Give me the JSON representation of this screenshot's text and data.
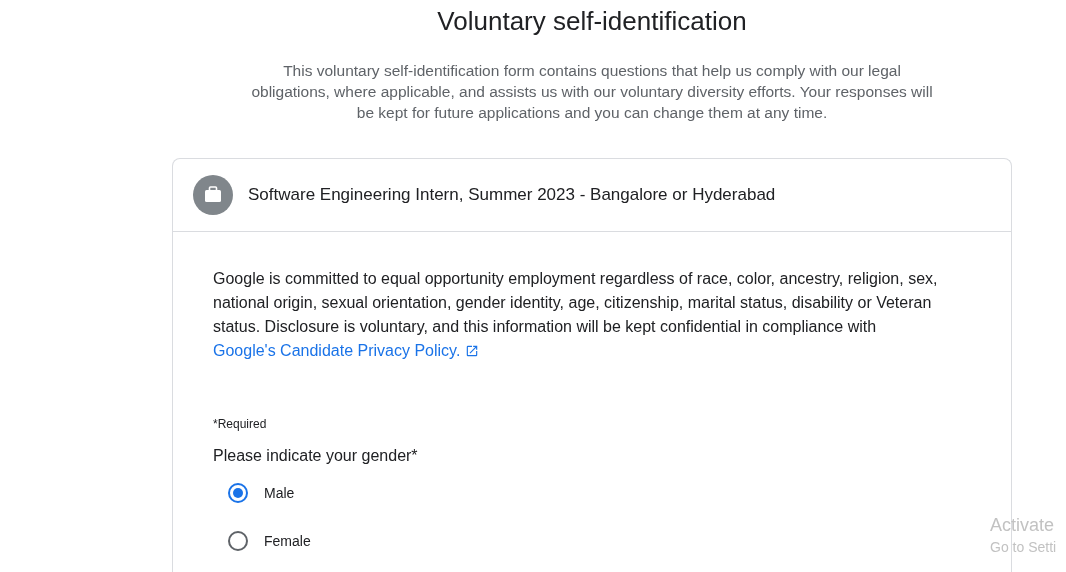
{
  "page": {
    "title": "Voluntary self-identification",
    "description": "This voluntary self-identification form contains questions that help us comply with our legal obligations, where applicable, and assists us with our voluntary diversity efforts. Your responses will be kept for future applications and you can change them at any time."
  },
  "card": {
    "job_title": "Software Engineering Intern, Summer 2023 - Bangalore or Hyderabad",
    "statement": "Google is committed to equal opportunity employment regardless of race, color, ancestry, religion, sex, national origin, sexual orientation, gender identity, age, citizenship, marital status, disability or Veteran status. Disclosure is voluntary, and this information will be kept confidential in compliance with",
    "policy_link": "Google's Candidate Privacy Policy.",
    "required_note": "*Required",
    "question": "Please indicate your gender*",
    "options": [
      {
        "label": "Male",
        "selected": true
      },
      {
        "label": "Female",
        "selected": false
      }
    ]
  },
  "os_notice": {
    "title": "Activate",
    "subtitle": "Go to Setti"
  }
}
